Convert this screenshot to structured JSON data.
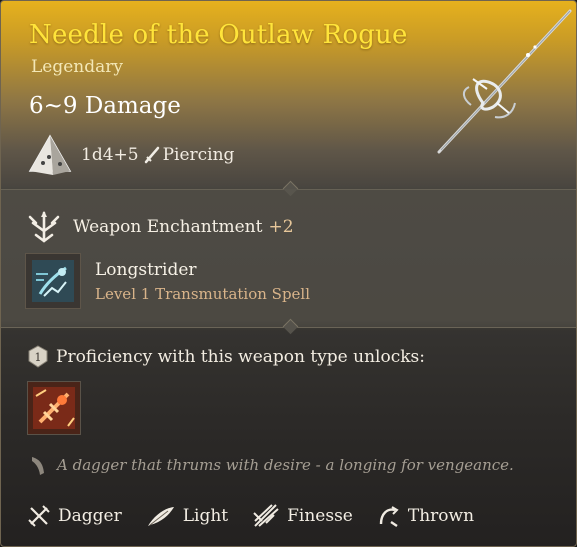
{
  "item": {
    "name": "Needle of the Outlaw Rogue",
    "rarity": "Legendary",
    "damage": "6~9 Damage",
    "dice": "1d4+5",
    "damage_type": "Piercing"
  },
  "enchantment": {
    "title": "Weapon Enchantment",
    "bonus": "+2"
  },
  "spell": {
    "name": "Longstrider",
    "level": "Level 1 Transmutation Spell"
  },
  "proficiency": {
    "label": "Proficiency with this weapon type unlocks:"
  },
  "description": "A dagger that thrums with desire - a longing for vengeance.",
  "properties": [
    {
      "label": "Dagger",
      "icon": "dagger-icon"
    },
    {
      "label": "Light",
      "icon": "feather-icon"
    },
    {
      "label": "Finesse",
      "icon": "finesse-icon"
    },
    {
      "label": "Thrown",
      "icon": "thrown-icon"
    }
  ],
  "colors": {
    "legendary_name": "#ffe43a",
    "rarity": "#f3e7b6",
    "bonus": "#e7c79a",
    "spell_level": "#d9b48a",
    "description": "#a59e93"
  }
}
